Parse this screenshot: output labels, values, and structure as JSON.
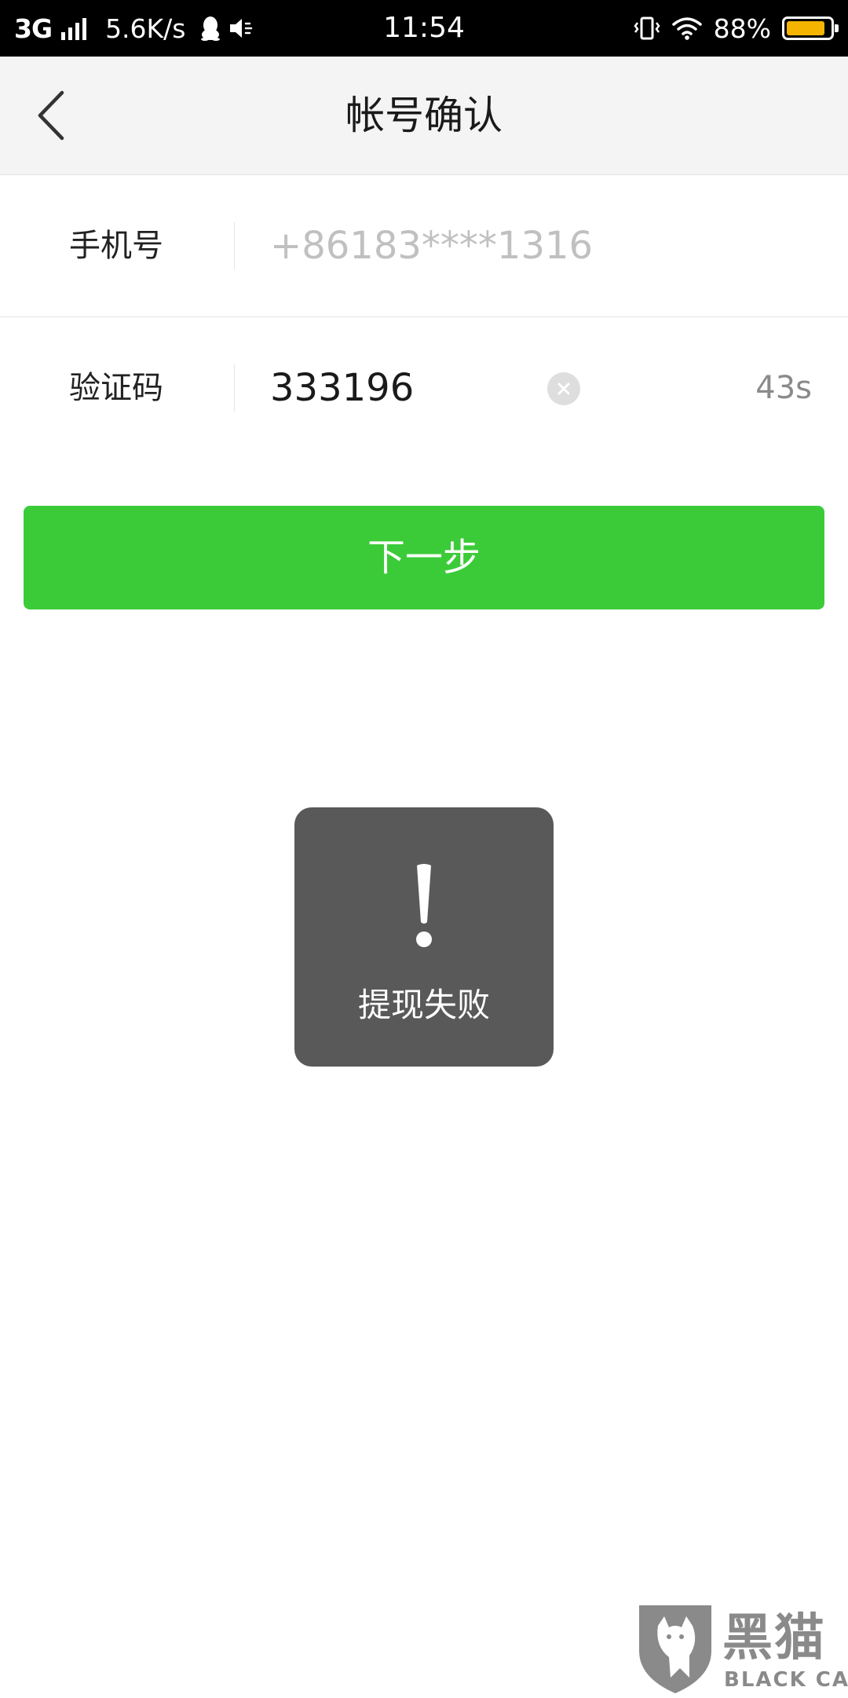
{
  "status_bar": {
    "network": "3G",
    "speed": "5.6K/s",
    "time": "11:54",
    "battery": "88%",
    "battery_level": 0.88,
    "battery_color": "#f4b400"
  },
  "nav": {
    "back_icon": "chevron-left-icon",
    "title": "帐号确认"
  },
  "form": {
    "phone_label": "手机号",
    "phone_value": "+86183****1316",
    "code_label": "验证码",
    "code_value": "333196",
    "clear_icon": "clear-icon",
    "countdown": "43s"
  },
  "next_button": {
    "label": "下一步",
    "color": "#3ccb38"
  },
  "toast": {
    "icon": "exclamation-icon",
    "message": "提现失败"
  },
  "watermark": {
    "cn": "黑猫",
    "en": "BLACK CAT"
  }
}
